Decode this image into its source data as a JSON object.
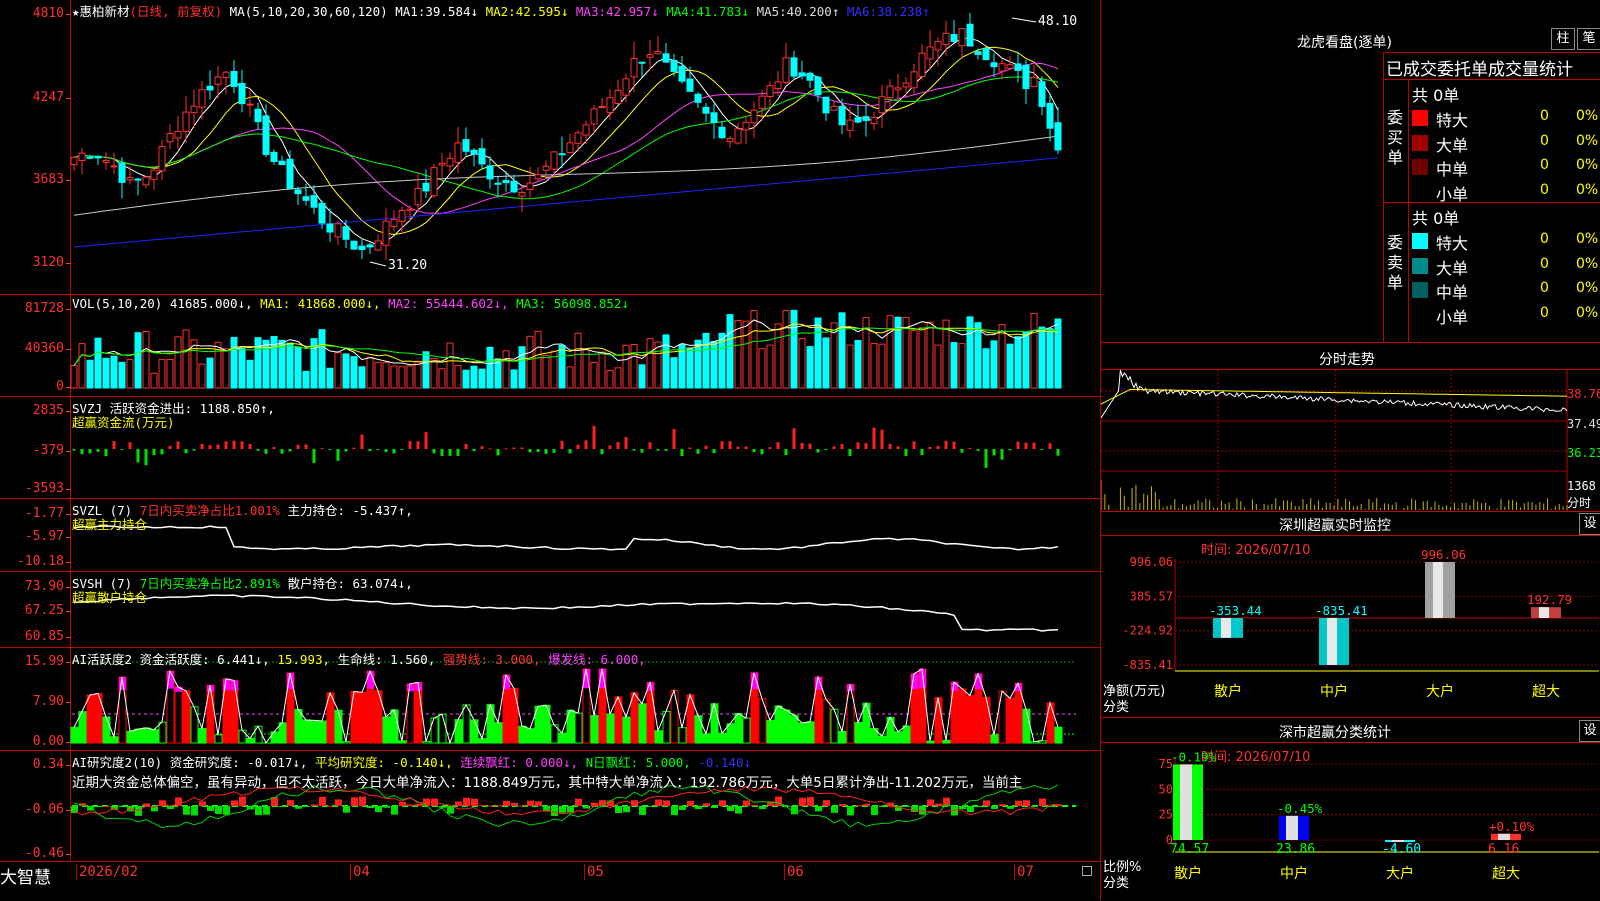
{
  "app": {
    "name": "大智慧"
  },
  "stock": {
    "name": "★惠柏新材",
    "mode": "(日线, 前复权)"
  },
  "main": {
    "ma_label": "MA(5,10,20,30,60,120)",
    "ma": [
      {
        "label": "MA1:",
        "value": "39.584↓",
        "color": "#ffffff"
      },
      {
        "label": "MA2:",
        "value": "42.595↓",
        "color": "#ffff00"
      },
      {
        "label": "MA3:",
        "value": "42.957↓",
        "color": "#ff40ff"
      },
      {
        "label": "MA4:",
        "value": "41.783↓",
        "color": "#00ff00"
      },
      {
        "label": "MA5:",
        "value": "40.200↑",
        "color": "#c0c0c0"
      },
      {
        "label": "MA6:",
        "value": "38.238↑",
        "color": "#3030ff"
      }
    ],
    "y_ticks": [
      "4810",
      "4247",
      "3683",
      "3120"
    ],
    "high_label": "48.10",
    "low_label": "31.20"
  },
  "vol": {
    "header": "VOL(5,10,20)",
    "value": "41685.000↓,",
    "ma1": "MA1: 41868.000↓,",
    "ma2": "MA2: 55444.602↓,",
    "ma3": "MA3: 56098.852↓",
    "y_ticks": [
      "81728",
      "40360",
      "0"
    ]
  },
  "svzj": {
    "header": "SVZJ  活跃资金进出: 1188.850↑,",
    "title": "超赢资金流(万元)",
    "y_ticks": [
      "2835",
      "-379",
      "-3593"
    ]
  },
  "svzl": {
    "header_a": "SVZL (7)",
    "header_b": "7日内买卖净占比1.001%",
    "header_c": "主力持仓: -5.437↑,",
    "title": "超赢主力持仓",
    "y_ticks": [
      "-1.77",
      "-5.97",
      "-10.18"
    ]
  },
  "svsh": {
    "header_a": "SVSH (7)",
    "header_b": "7日内买卖净占比2.891%",
    "header_c": "散户持仓: 63.074↓,",
    "title": "超赢散户持仓",
    "y_ticks": [
      "73.90",
      "67.25",
      "60.85"
    ]
  },
  "ai_active": {
    "header_a": "AI活跃度2 资金活跃度: 6.441↓,",
    "header_b": "15.993,",
    "header_c": "生命线: 1.560,",
    "header_d": "强势线: 3.000,",
    "header_e": "爆发线: 6.000,",
    "y_ticks": [
      "15.99",
      "7.90",
      "0.00"
    ]
  },
  "ai_research": {
    "header_a": "AI研究度2(10) 资金研究度: -0.017↓,",
    "header_b": "平均研究度: -0.140↓,",
    "header_c": "连续飘红: 0.000↓,",
    "header_d": "N日飘红: 5.000,",
    "header_e": "-0.140↓",
    "text": "近期大资金总体偏空，虽有异动，但不太活跃，今日大单净流入：1188.849万元，其中特大单净流入：192.786万元，大单5日累计净出-11.202万元，当前主",
    "y_ticks": [
      "0.34",
      "-0.06",
      "-0.46"
    ]
  },
  "x_axis": [
    "2026/02",
    "04",
    "05",
    "06",
    "07"
  ],
  "right": {
    "dragon": {
      "title": "龙虎看盘(逐单)",
      "btn1": "柱",
      "btn2": "笔",
      "subtitle": "已成交委托单成交量统计",
      "buy": {
        "side": "委买单",
        "total": "共 0单",
        "rows": [
          {
            "label": "特大",
            "count": "0",
            "pct": "0%",
            "color": "#ff0000"
          },
          {
            "label": "大单",
            "count": "0",
            "pct": "0%",
            "color": "#a00000"
          },
          {
            "label": "中单",
            "count": "0",
            "pct": "0%",
            "color": "#700000"
          },
          {
            "label": "小单",
            "count": "0",
            "pct": "0%",
            "color": "#000000"
          }
        ]
      },
      "sell": {
        "side": "委卖单",
        "total": "共 0单",
        "rows": [
          {
            "label": "特大",
            "count": "0",
            "pct": "0%",
            "color": "#00ffff"
          },
          {
            "label": "大单",
            "count": "0",
            "pct": "0%",
            "color": "#008a8a"
          },
          {
            "label": "中单",
            "count": "0",
            "pct": "0%",
            "color": "#006060"
          },
          {
            "label": "小单",
            "count": "0",
            "pct": "0%",
            "color": "#000000"
          }
        ]
      }
    },
    "intraday": {
      "title": "分时走势",
      "y_ticks": [
        "38.76",
        "37.49",
        "36.23"
      ],
      "vol_tick": "1368",
      "vol_unit": "分时"
    },
    "sz_monitor": {
      "title": "深圳超赢实时监控",
      "btn": "设",
      "time": "时间: 2026/07/10",
      "y_ticks": [
        "996.06",
        "385.57",
        "-224.92",
        "-835.41"
      ],
      "axis_title": "净额(万元)",
      "axis_cat": "分类",
      "chart_data": {
        "type": "bar",
        "categories": [
          "散户",
          "中户",
          "大户",
          "超大"
        ],
        "values": [
          -353.44,
          -835.41,
          996.06,
          192.79
        ],
        "value_labels": [
          "-353.44",
          "-835.41",
          "996.06",
          "192.79"
        ]
      }
    },
    "sz_class": {
      "title": "深市超赢分类统计",
      "btn": "设",
      "time": "时间: 2026/07/10",
      "y_ticks": [
        "75",
        "50",
        "25",
        "0"
      ],
      "axis_title": "比例%",
      "axis_cat": "分类",
      "chart_data": {
        "type": "bar",
        "categories": [
          "散户",
          "中户",
          "大户",
          "超大"
        ],
        "values": [
          74.57,
          23.86,
          -4.6,
          6.16
        ],
        "change_labels": [
          "-0.19%",
          "-0.45%",
          "",
          "+0.10%"
        ],
        "value_labels": [
          "74.57",
          "23.86",
          "-4.60",
          "6.16"
        ]
      }
    }
  }
}
